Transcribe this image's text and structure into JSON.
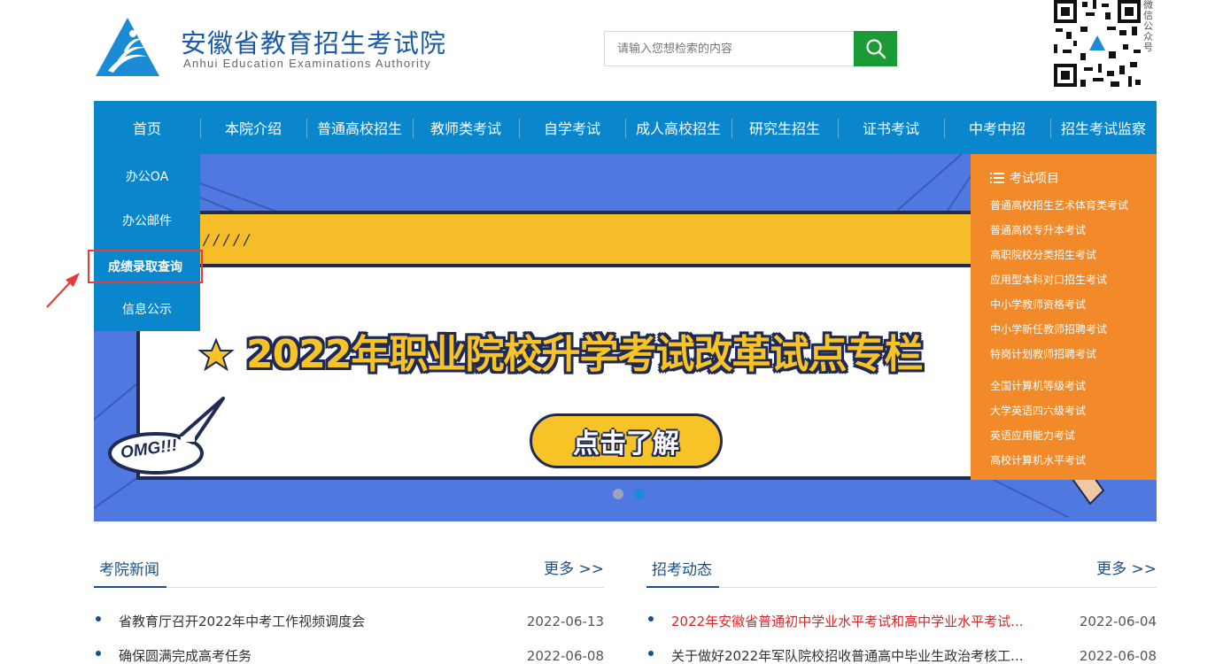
{
  "header": {
    "title": "安徽省教育招生考试院",
    "subtitle": "Anhui Education Examinations Authority",
    "search_placeholder": "请输入您想检索的内容",
    "qr_label": "微信公众号",
    "brand_color": "#0a86cc"
  },
  "nav": {
    "items": [
      "首页",
      "本院介绍",
      "普通高校招生",
      "教师类考试",
      "自学考试",
      "成人高校招生",
      "研究生招生",
      "证书考试",
      "中考中招",
      "招生考试监察"
    ]
  },
  "dropdown": {
    "items": [
      "办公OA",
      "办公邮件",
      "成绩录取查询",
      "信息公示"
    ],
    "highlighted": "成绩录取查询"
  },
  "banner": {
    "marks": "/////",
    "title": "2022年职业院校升学考试改革试点专栏",
    "cta": "点击了解",
    "bubble": "OMG!!!",
    "slide_count": 2,
    "active_slide": 2
  },
  "side_panel": {
    "heading": "考试项目",
    "color": "#f28a29",
    "group1": [
      "普通高校招生艺术体育类考试",
      "普通高校专升本考试",
      "高职院校分类招生考试",
      "应用型本科对口招生考试",
      "中小学教师资格考试",
      "中小学新任教师招聘考试",
      "特岗计划教师招聘考试"
    ],
    "group2": [
      "全国计算机等级考试",
      "大学英语四六级考试",
      "英语应用能力考试",
      "高校计算机水平考试"
    ]
  },
  "news_left": {
    "title": "考院新闻",
    "more": "更多 >>",
    "items": [
      {
        "title": "省教育厅召开2022年中考工作视频调度会",
        "date": "2022-06-13"
      },
      {
        "title": "确保圆满完成高考任务",
        "date": "2022-06-08"
      }
    ]
  },
  "news_right": {
    "title": "招考动态",
    "more": "更多 >>",
    "items": [
      {
        "title": "2022年安徽省普通初中学业水平考试和高中学业水平考试...",
        "date": "2022-06-04"
      },
      {
        "title": "关于做好2022年军队院校招收普通高中毕业生政治考核工...",
        "date": "2022-06-08"
      }
    ]
  }
}
